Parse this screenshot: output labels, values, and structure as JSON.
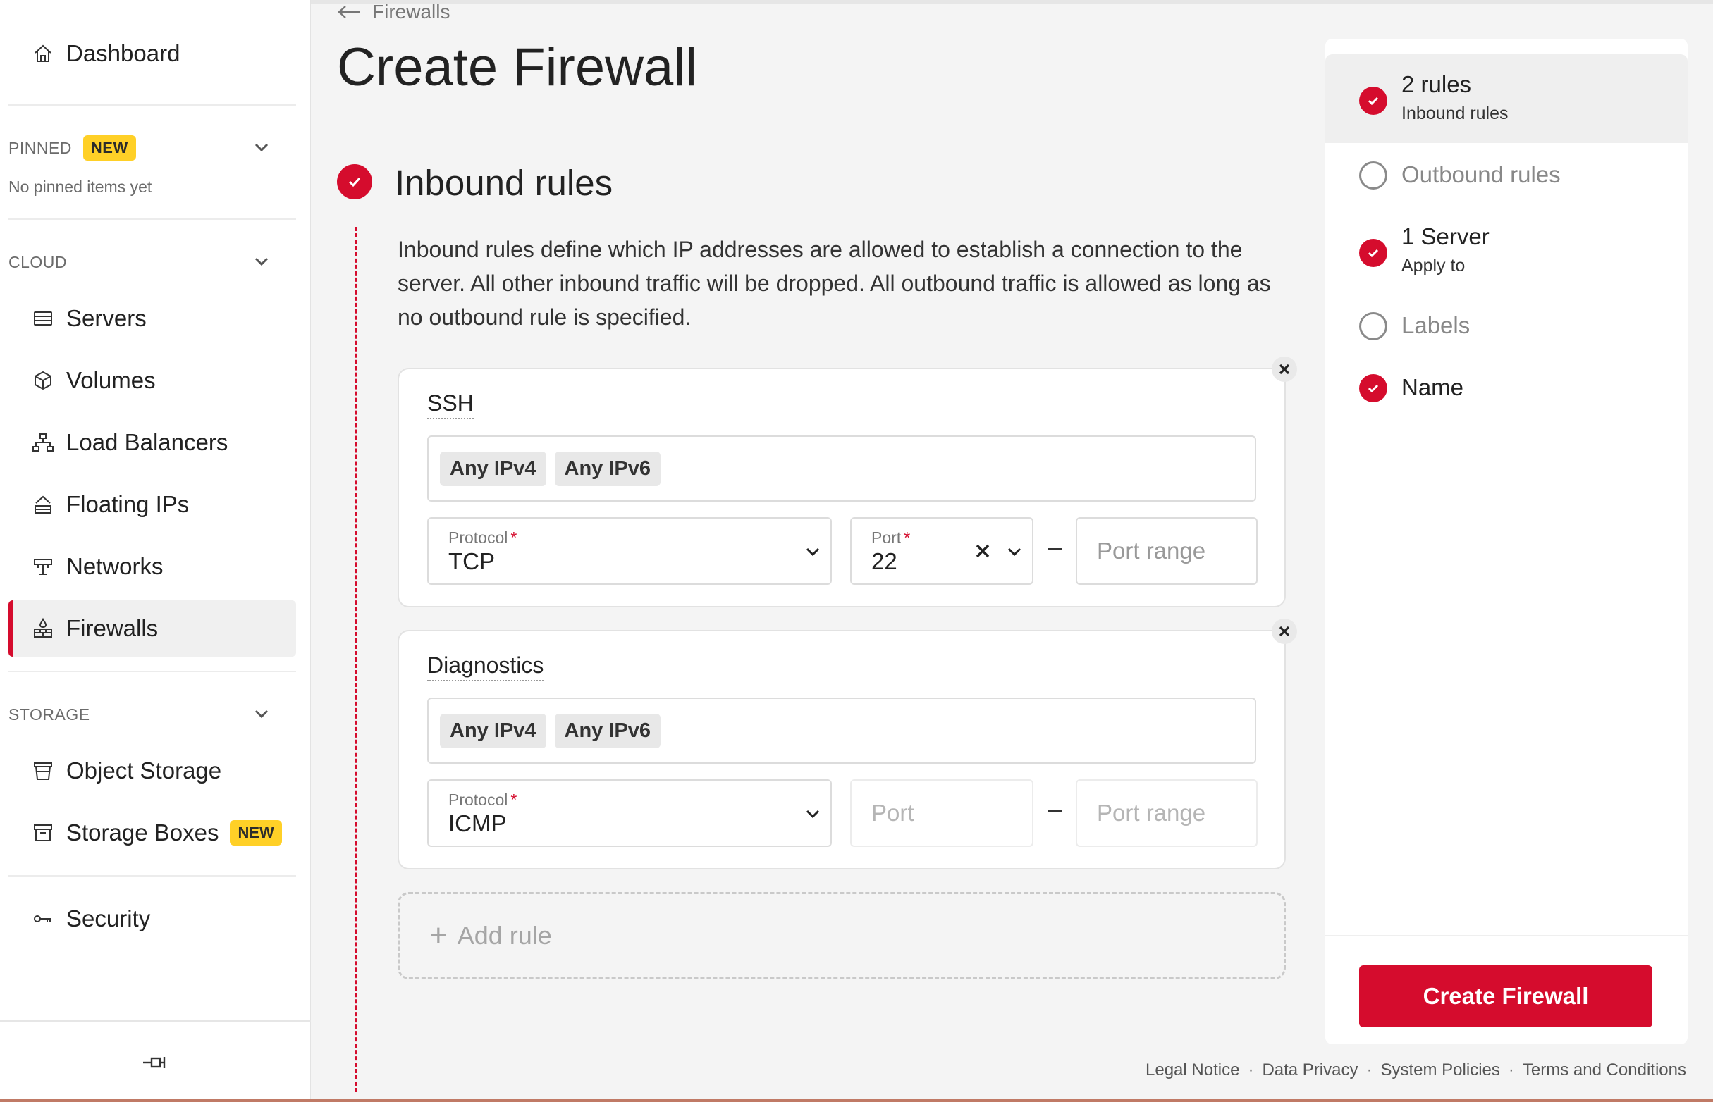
{
  "sidebar": {
    "dashboard": "Dashboard",
    "pinned": {
      "heading": "PINNED",
      "badge": "NEW",
      "empty_text": "No pinned items yet"
    },
    "cloud": {
      "heading": "CLOUD",
      "items": [
        {
          "label": "Servers",
          "icon": "server-icon"
        },
        {
          "label": "Volumes",
          "icon": "cube-icon"
        },
        {
          "label": "Load Balancers",
          "icon": "load-balancer-icon"
        },
        {
          "label": "Floating IPs",
          "icon": "floating-ip-icon"
        },
        {
          "label": "Networks",
          "icon": "network-icon"
        },
        {
          "label": "Firewalls",
          "icon": "firewall-icon",
          "active": true
        }
      ]
    },
    "storage": {
      "heading": "STORAGE",
      "items": [
        {
          "label": "Object Storage",
          "icon": "bucket-icon"
        },
        {
          "label": "Storage Boxes",
          "icon": "storage-box-icon",
          "badge": "NEW"
        }
      ]
    },
    "security": "Security"
  },
  "main": {
    "breadcrumb": "Firewalls",
    "title": "Create Firewall",
    "section": {
      "title": "Inbound rules",
      "description": "Inbound rules define which IP addresses are allowed to establish a connection to the server. All other inbound traffic will be dropped. All outbound traffic is allowed as long as no outbound rule is specified."
    },
    "rules": [
      {
        "name": "SSH",
        "sources": [
          "Any IPv4",
          "Any IPv6"
        ],
        "protocol_label": "Protocol",
        "protocol": "TCP",
        "port_label": "Port",
        "port": "22",
        "port_range_placeholder": "Port range"
      },
      {
        "name": "Diagnostics",
        "sources": [
          "Any IPv4",
          "Any IPv6"
        ],
        "protocol_label": "Protocol",
        "protocol": "ICMP",
        "port_placeholder": "Port",
        "port_range_placeholder": "Port range"
      }
    ],
    "required_mark": "*",
    "add_rule": "Add rule"
  },
  "summary": {
    "steps": [
      {
        "title": "2 rules",
        "subtitle": "Inbound rules",
        "status": "done"
      },
      {
        "title": "Outbound rules",
        "status": "todo"
      },
      {
        "title": "1 Server",
        "subtitle": "Apply to",
        "status": "done"
      },
      {
        "title": "Labels",
        "status": "todo"
      },
      {
        "title": "Name",
        "status": "done"
      }
    ],
    "create_button": "Create Firewall"
  },
  "footer": {
    "links": [
      "Legal Notice",
      "Data Privacy",
      "System Policies",
      "Terms and Conditions"
    ],
    "separator": "·"
  },
  "colors": {
    "accent": "#d50c2d",
    "badge": "#ffd027"
  }
}
